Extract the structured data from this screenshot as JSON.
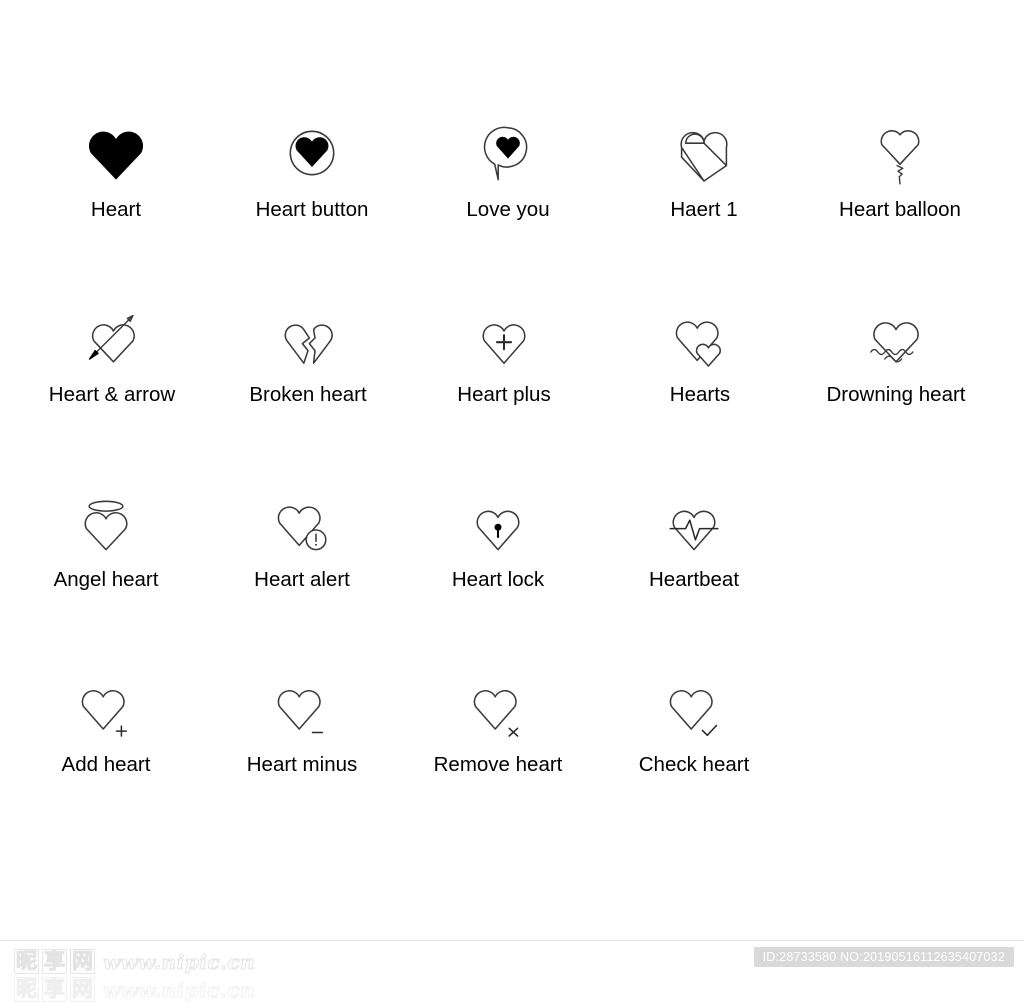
{
  "page": {
    "background_color": "#ffffff",
    "stroke_color": "#3a3a3a",
    "fill_color": "#000000",
    "label_color": "#000000"
  },
  "rows": [
    {
      "items": [
        {
          "icon": "heart-solid-icon",
          "label": "Heart"
        },
        {
          "icon": "heart-button-icon",
          "label": "Heart button"
        },
        {
          "icon": "love-you-speech-bubble-icon",
          "label": "Love you"
        },
        {
          "icon": "heart-outline-geometric-icon",
          "label": "Haert 1"
        },
        {
          "icon": "heart-balloon-icon",
          "label": "Heart balloon"
        }
      ]
    },
    {
      "items": [
        {
          "icon": "heart-and-arrow-icon",
          "label": "Heart & arrow"
        },
        {
          "icon": "broken-heart-icon",
          "label": "Broken heart"
        },
        {
          "icon": "heart-plus-icon",
          "label": "Heart plus"
        },
        {
          "icon": "two-hearts-icon",
          "label": "Hearts"
        },
        {
          "icon": "drowning-heart-icon",
          "label": "Drowning heart"
        }
      ]
    },
    {
      "items": [
        {
          "icon": "angel-heart-icon",
          "label": "Angel heart"
        },
        {
          "icon": "heart-alert-icon",
          "label": "Heart alert"
        },
        {
          "icon": "heart-lock-icon",
          "label": "Heart lock"
        },
        {
          "icon": "heartbeat-icon",
          "label": "Heartbeat"
        }
      ]
    },
    {
      "items": [
        {
          "icon": "add-heart-icon",
          "label": "Add heart"
        },
        {
          "icon": "heart-minus-icon",
          "label": "Heart minus"
        },
        {
          "icon": "remove-heart-icon",
          "label": "Remove heart"
        },
        {
          "icon": "check-heart-icon",
          "label": "Check heart"
        }
      ]
    }
  ],
  "footer": {
    "watermark_cjk": [
      "昵",
      "享",
      "网"
    ],
    "watermark_url": "www.nipic.cn",
    "id_badge": "ID:28733580 NO:20190516112635407032"
  }
}
